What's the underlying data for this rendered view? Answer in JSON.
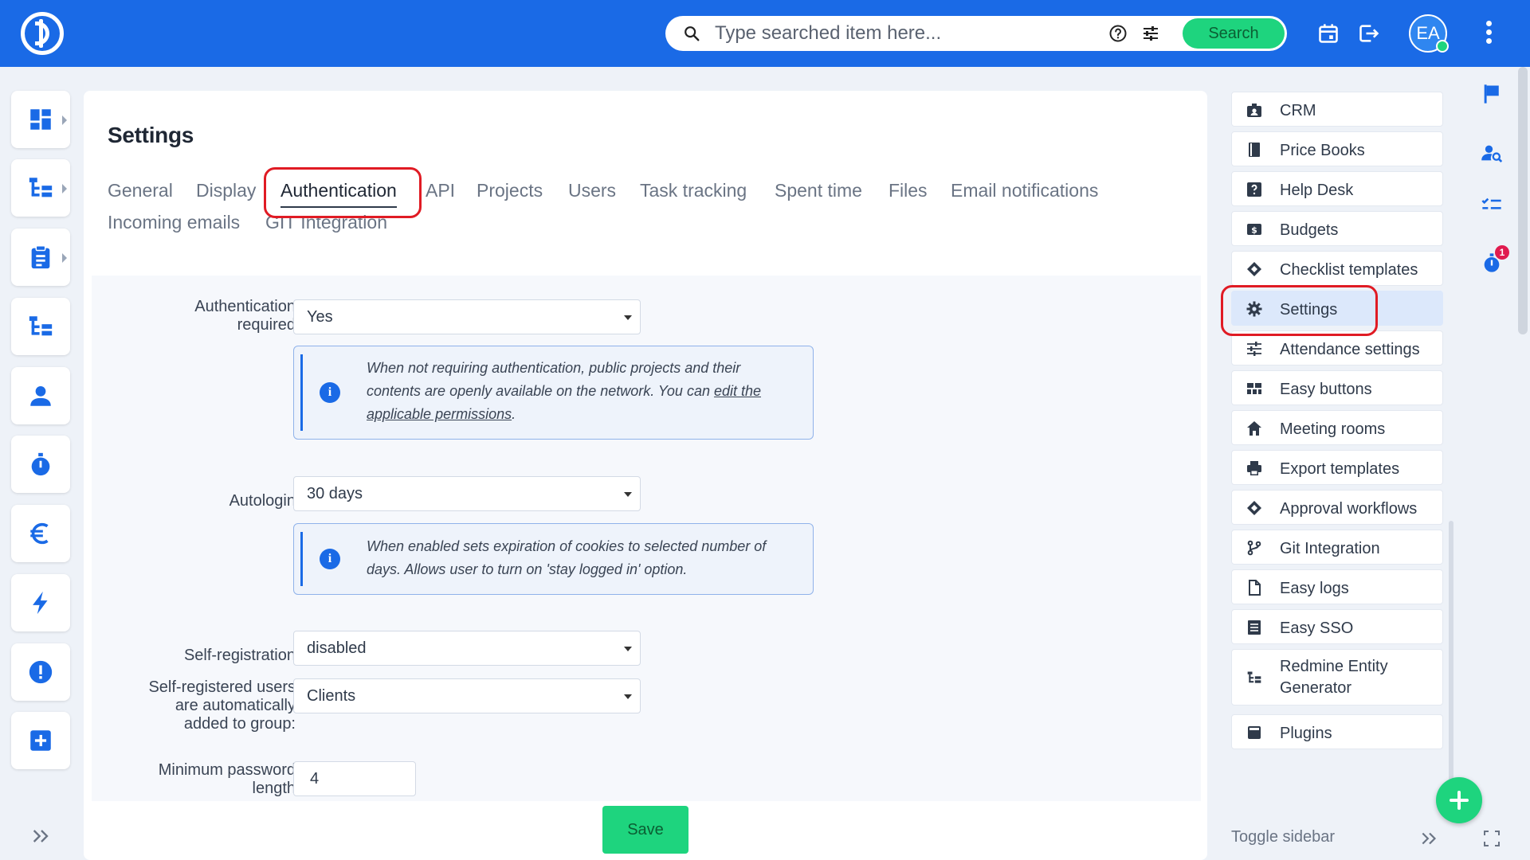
{
  "topbar": {
    "search_placeholder": "Type searched item here...",
    "search_button": "Search",
    "avatar_initials": "EA",
    "brand_color": "#1a6ae6",
    "accent_color": "#1ed47e"
  },
  "left_sidebar": {
    "items": [
      {
        "icon": "dashboard-icon",
        "has_submenu": true
      },
      {
        "icon": "hierarchy-icon",
        "has_submenu": true
      },
      {
        "icon": "clipboard-icon",
        "has_submenu": true
      },
      {
        "icon": "hierarchy-icon",
        "has_submenu": false
      },
      {
        "icon": "user-icon",
        "has_submenu": false
      },
      {
        "icon": "stopwatch-icon",
        "has_submenu": false
      },
      {
        "icon": "euro-icon",
        "has_submenu": false
      },
      {
        "icon": "lightning-icon",
        "has_submenu": false
      },
      {
        "icon": "alert-icon",
        "has_submenu": false
      },
      {
        "icon": "add-box-icon",
        "has_submenu": false
      }
    ]
  },
  "main": {
    "title": "Settings",
    "tabs": [
      {
        "label": "General"
      },
      {
        "label": "Display"
      },
      {
        "label": "Authentication",
        "active": true
      },
      {
        "label": "API"
      },
      {
        "label": "Projects"
      },
      {
        "label": "Users"
      },
      {
        "label": "Task tracking"
      },
      {
        "label": "Spent time"
      },
      {
        "label": "Files"
      },
      {
        "label": "Email notifications"
      },
      {
        "label": "Incoming emails"
      },
      {
        "label": "GIT Integration"
      }
    ],
    "form": {
      "auth_required": {
        "label": "Authentication required",
        "value": "Yes"
      },
      "auth_note": {
        "text_before": "When not requiring authentication, public projects and their contents are openly available on the network. You can ",
        "link": "edit the applicable permissions",
        "text_after": "."
      },
      "autologin": {
        "label": "Autologin",
        "value": "30 days"
      },
      "autologin_note": {
        "text": "When enabled sets expiration of cookies to selected number of days. Allows user to turn on 'stay logged in' option."
      },
      "self_registration": {
        "label": "Self-registration",
        "value": "disabled"
      },
      "self_registered_group": {
        "label": "Self-registered users are automatically added to group:",
        "value": "Clients"
      },
      "min_password": {
        "label": "Minimum password length",
        "value": "4"
      }
    },
    "save_button": "Save"
  },
  "right_menu": {
    "items": [
      {
        "label": "CRM",
        "icon": "crm-icon"
      },
      {
        "label": "Price Books",
        "icon": "book-icon"
      },
      {
        "label": "Help Desk",
        "icon": "question-icon"
      },
      {
        "label": "Budgets",
        "icon": "money-icon"
      },
      {
        "label": "Checklist templates",
        "icon": "diamond-icon"
      },
      {
        "label": "Settings",
        "icon": "gear-icon",
        "active": true
      },
      {
        "label": "Attendance settings",
        "icon": "sliders-icon"
      },
      {
        "label": "Easy buttons",
        "icon": "grid-icon"
      },
      {
        "label": "Meeting rooms",
        "icon": "home-icon"
      },
      {
        "label": "Export templates",
        "icon": "printer-icon"
      },
      {
        "label": "Approval workflows",
        "icon": "diamond-icon"
      },
      {
        "label": "Git Integration",
        "icon": "git-branch-icon"
      },
      {
        "label": "Easy logs",
        "icon": "file-icon"
      },
      {
        "label": "Easy SSO",
        "icon": "list-icon"
      },
      {
        "label": "Redmine Entity Generator",
        "icon": "hierarchy-icon"
      },
      {
        "label": "Plugins",
        "icon": "plugin-icon"
      }
    ],
    "toggle_label": "Toggle sidebar"
  },
  "right_rail": {
    "timer_badge": "1"
  }
}
